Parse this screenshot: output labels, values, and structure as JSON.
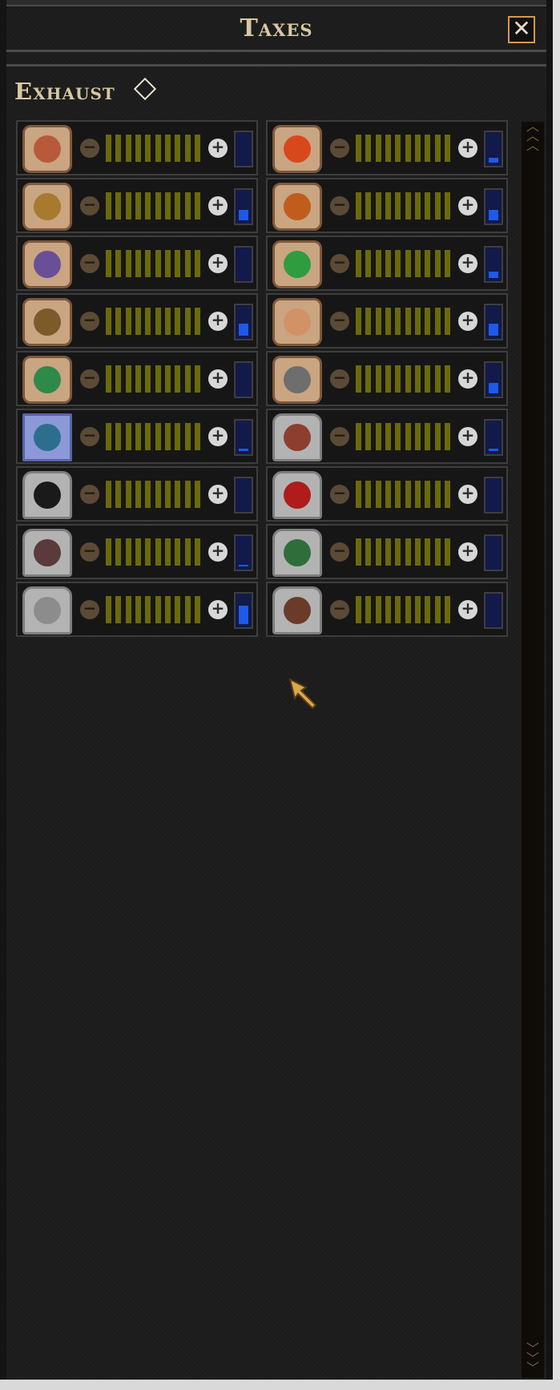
{
  "window": {
    "title": "Taxes"
  },
  "section": {
    "label": "Exhaust"
  },
  "resources": [
    {
      "icon": "alcohol-icon",
      "frame": "tan",
      "glyph_color": "#b85a3a",
      "fill": 0.0
    },
    {
      "icon": "fruit-icon",
      "frame": "tan",
      "glyph_color": "#d9481d",
      "fill": 0.15
    },
    {
      "icon": "grain-icon",
      "frame": "tan",
      "glyph_color": "#a77a2d",
      "fill": 0.35
    },
    {
      "icon": "mushroom-icon",
      "frame": "tan",
      "glyph_color": "#c05d1d",
      "fill": 0.35
    },
    {
      "icon": "egg-icon",
      "frame": "tan",
      "glyph_color": "#6a4f97",
      "fill": 0.0
    },
    {
      "icon": "vegetable-icon",
      "frame": "tan",
      "glyph_color": "#2f9d3f",
      "fill": 0.2
    },
    {
      "icon": "cattle-icon",
      "frame": "tan",
      "glyph_color": "#7c5a2a",
      "fill": 0.4
    },
    {
      "icon": "pig-icon",
      "frame": "tan",
      "glyph_color": "#d39266",
      "fill": 0.4
    },
    {
      "icon": "reptile-icon",
      "frame": "tan",
      "glyph_color": "#2f8a4a",
      "fill": 0.0
    },
    {
      "icon": "ram-horn-icon",
      "frame": "tan",
      "glyph_color": "#6e6e6e",
      "fill": 0.35
    },
    {
      "icon": "fish-icon",
      "frame": "blue",
      "glyph_color": "#2c6f8c",
      "fill": 0.08
    },
    {
      "icon": "meat-icon",
      "frame": "gray",
      "glyph_color": "#8d3e2f",
      "fill": 0.08
    },
    {
      "icon": "coal-icon",
      "frame": "gray",
      "glyph_color": "#1a1a1a",
      "fill": 0.0
    },
    {
      "icon": "gem-icon",
      "frame": "gray",
      "glyph_color": "#b01b1b",
      "fill": 0.0
    },
    {
      "icon": "iron-ore-icon",
      "frame": "gray",
      "glyph_color": "#5a3a3a",
      "fill": 0.06
    },
    {
      "icon": "copper-ore-icon",
      "frame": "gray",
      "glyph_color": "#2f6e3b",
      "fill": 0.0
    },
    {
      "icon": "stone-icon",
      "frame": "gray",
      "glyph_color": "#8c8c8c",
      "fill": 0.6
    },
    {
      "icon": "wood-icon",
      "frame": "gray",
      "glyph_color": "#6b3b2a",
      "fill": 0.0
    }
  ],
  "colors": {
    "title": "#d8c7a2",
    "slider": "#6b6a0b",
    "meter_bg": "#121a4a",
    "meter_fill": "#1e59e8"
  }
}
